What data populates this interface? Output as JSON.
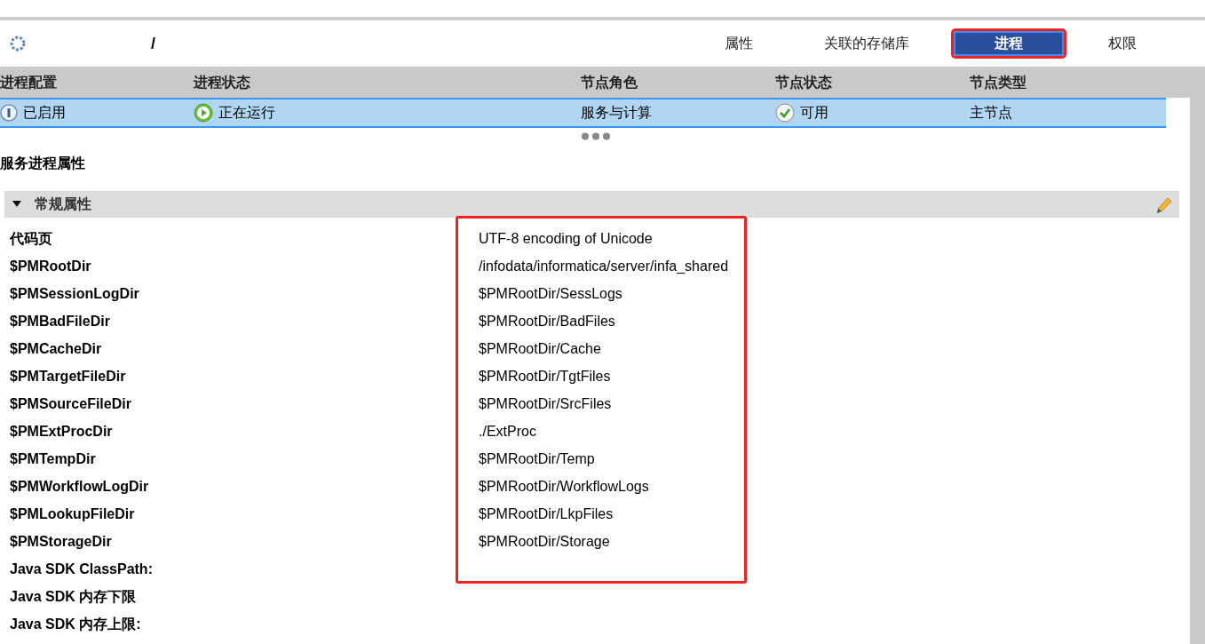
{
  "header": {
    "title": "/"
  },
  "tabs": [
    {
      "label": "属性",
      "selected": false
    },
    {
      "label": "关联的存储库",
      "selected": false
    },
    {
      "label": "进程",
      "selected": true
    },
    {
      "label": "权限",
      "selected": false
    }
  ],
  "table": {
    "columns": [
      "进程配置",
      "进程状态",
      null,
      "节点角色",
      "节点状态",
      "节点类型"
    ],
    "rows": [
      {
        "selected": true,
        "cells": [
          {
            "kind": "enabled",
            "text": "已启用"
          },
          {
            "kind": "running",
            "text": "正在运行"
          },
          {
            "kind": "blank"
          },
          {
            "kind": "text",
            "text": "服务与计算"
          },
          {
            "kind": "ok",
            "text": "可用"
          },
          {
            "kind": "text",
            "text": "主节点"
          }
        ]
      }
    ]
  },
  "section_title": "服务进程属性",
  "group": {
    "title": "常规属性",
    "expanded": true
  },
  "properties": [
    {
      "name": "代码页",
      "value": "UTF-8 encoding of Unicode"
    },
    {
      "name": "$PMRootDir",
      "value": "/infodata/informatica/server/infa_shared"
    },
    {
      "name": "$PMSessionLogDir",
      "value": "$PMRootDir/SessLogs"
    },
    {
      "name": "$PMBadFileDir",
      "value": "$PMRootDir/BadFiles"
    },
    {
      "name": "$PMCacheDir",
      "value": "$PMRootDir/Cache"
    },
    {
      "name": "$PMTargetFileDir",
      "value": "$PMRootDir/TgtFiles"
    },
    {
      "name": "$PMSourceFileDir",
      "value": "$PMRootDir/SrcFiles"
    },
    {
      "name": "$PMExtProcDir",
      "value": "./ExtProc"
    },
    {
      "name": "$PMTempDir",
      "value": "$PMRootDir/Temp"
    },
    {
      "name": "$PMWorkflowLogDir",
      "value": "$PMRootDir/WorkflowLogs"
    },
    {
      "name": "$PMLookupFileDir",
      "value": "$PMRootDir/LkpFiles"
    },
    {
      "name": "$PMStorageDir",
      "value": "$PMRootDir/Storage"
    },
    {
      "name": "Java SDK ClassPath:"
    },
    {
      "name": "Java SDK 内存下限"
    },
    {
      "name": "Java SDK 内存上限:"
    }
  ]
}
